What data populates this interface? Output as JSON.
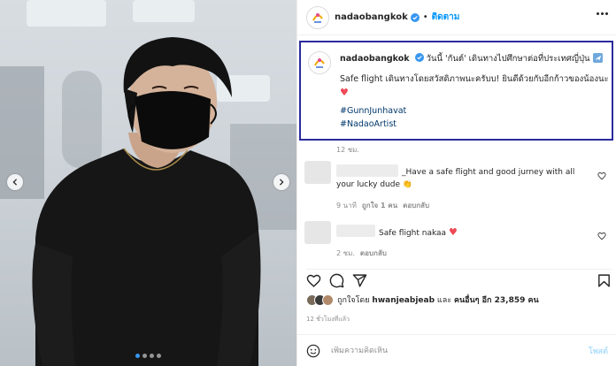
{
  "header": {
    "username": "nadaobangkok",
    "separator": "•",
    "follow_label": "ติดตาม"
  },
  "caption": {
    "username": "nadaobangkok",
    "line1": "วันนี้ 'กันต์' เดินทางไปศึกษาต่อที่ประเทศญี่ปุ่น",
    "line2": "Safe flight เดินทางโดยสวัสดิภาพนะครับบ! ยินดีด้วยกับอีกก้าวของน้องนะ",
    "hashtag1": "#GunnJunhavat",
    "hashtag2": "#NadaoArtist",
    "time": "12 ชม."
  },
  "comments": [
    {
      "text": "_Have a safe flight and good jurney with all your lucky dude",
      "emoji": "👏",
      "time": "9 นาที",
      "likes": "ถูกใจ 1 คน",
      "reply": "ตอบกลับ"
    },
    {
      "text": "Safe flight nakaa",
      "emoji": "♥",
      "time": "2 ชม.",
      "reply": "ตอบกลับ"
    }
  ],
  "likes": {
    "prefix": "ถูกใจโดย",
    "first_user": "hwanjeabjeab",
    "middle": "และ",
    "others": "คนอื่นๆ อีก 23,859 คน"
  },
  "post_age": "12 ชั่วโมงที่แล้ว",
  "add_comment": {
    "placeholder": "เพิ่มความคิดเห็น",
    "post_label": "โพสต์"
  },
  "colors": {
    "link_blue": "#0095f6",
    "caption_border": "#2a2b9c",
    "heart_red": "#ed4956",
    "hashtag": "#00376b"
  },
  "carousel": {
    "slide_count": 4,
    "active_slide": 1
  }
}
